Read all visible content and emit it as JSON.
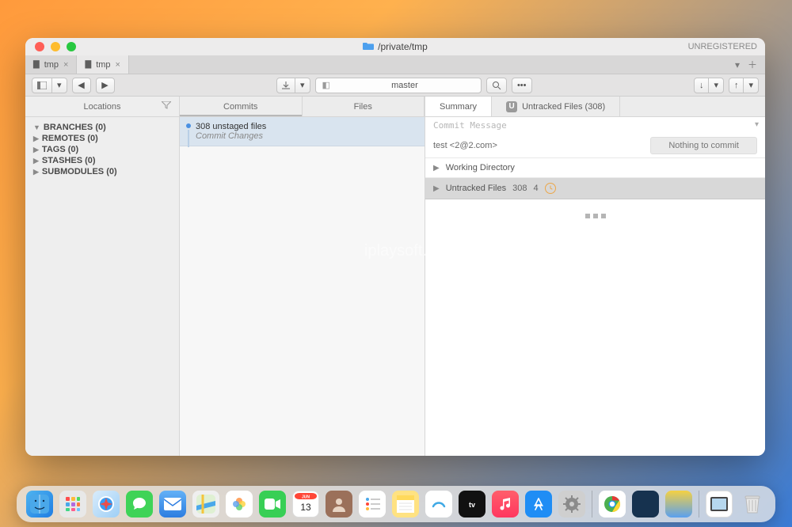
{
  "window": {
    "path": "/private/tmp",
    "unregistered": "UNREGISTERED"
  },
  "tabs": [
    {
      "label": "tmp",
      "active": false
    },
    {
      "label": "tmp",
      "active": true
    }
  ],
  "branch": "master",
  "sidebar": {
    "title": "Locations",
    "items": [
      "BRANCHES (0)",
      "REMOTES (0)",
      "TAGS (0)",
      "STASHES (0)",
      "SUBMODULES (0)"
    ]
  },
  "midTabs": {
    "commits": "Commits",
    "files": "Files"
  },
  "commit": {
    "title": "308 unstaged files",
    "sub": "Commit Changes"
  },
  "detailTabs": {
    "summary": "Summary",
    "untracked": "Untracked Files (308)"
  },
  "detail": {
    "commitMsgPlaceholder": "Commit Message",
    "author": "test <2@2.com>",
    "nothing": "Nothing to commit",
    "wd": "Working Directory",
    "untrackedLabel": "Untracked Files",
    "untrackedCount": "308",
    "untrackedExtra": "4"
  },
  "watermark": "iplaysoft.com",
  "calendar": {
    "month": "JUN",
    "day": "13"
  }
}
